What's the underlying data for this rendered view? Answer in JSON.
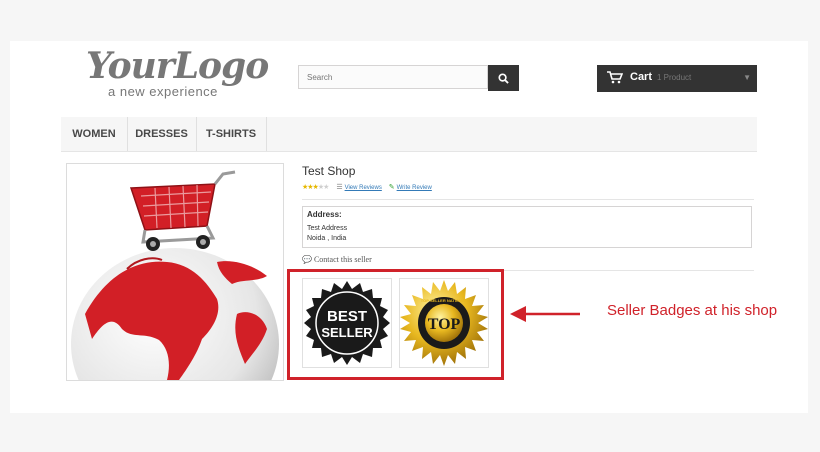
{
  "header": {
    "logo_brand": "YourLogo",
    "logo_tagline": "a new experience",
    "search_placeholder": "Search",
    "cart_label": "Cart",
    "cart_count": "1 Product"
  },
  "menu": {
    "items": [
      "WOMEN",
      "DRESSES",
      "T-SHIRTS"
    ]
  },
  "shop": {
    "name": "Test Shop",
    "rating": 3,
    "rating_max": 5,
    "view_reviews": "View Reviews",
    "write_review": "Write Review",
    "address_label": "Address:",
    "address_line1": "Test Address",
    "address_line2": "Noida , India",
    "contact": "Contact this seller"
  },
  "badges": [
    {
      "name": "best-seller-badge",
      "line1": "BEST",
      "line2": "SELLER"
    },
    {
      "name": "top-seller-badge",
      "text": "TOP",
      "ring_text": "TOP SELLER NATIONAL"
    }
  ],
  "annotation": {
    "callout": "Seller Badges at his shop",
    "color": "#d0222a"
  },
  "colors": {
    "dark": "#333333",
    "link": "#337ab7",
    "star": "#e6b800",
    "accent_red": "#d0222a"
  }
}
